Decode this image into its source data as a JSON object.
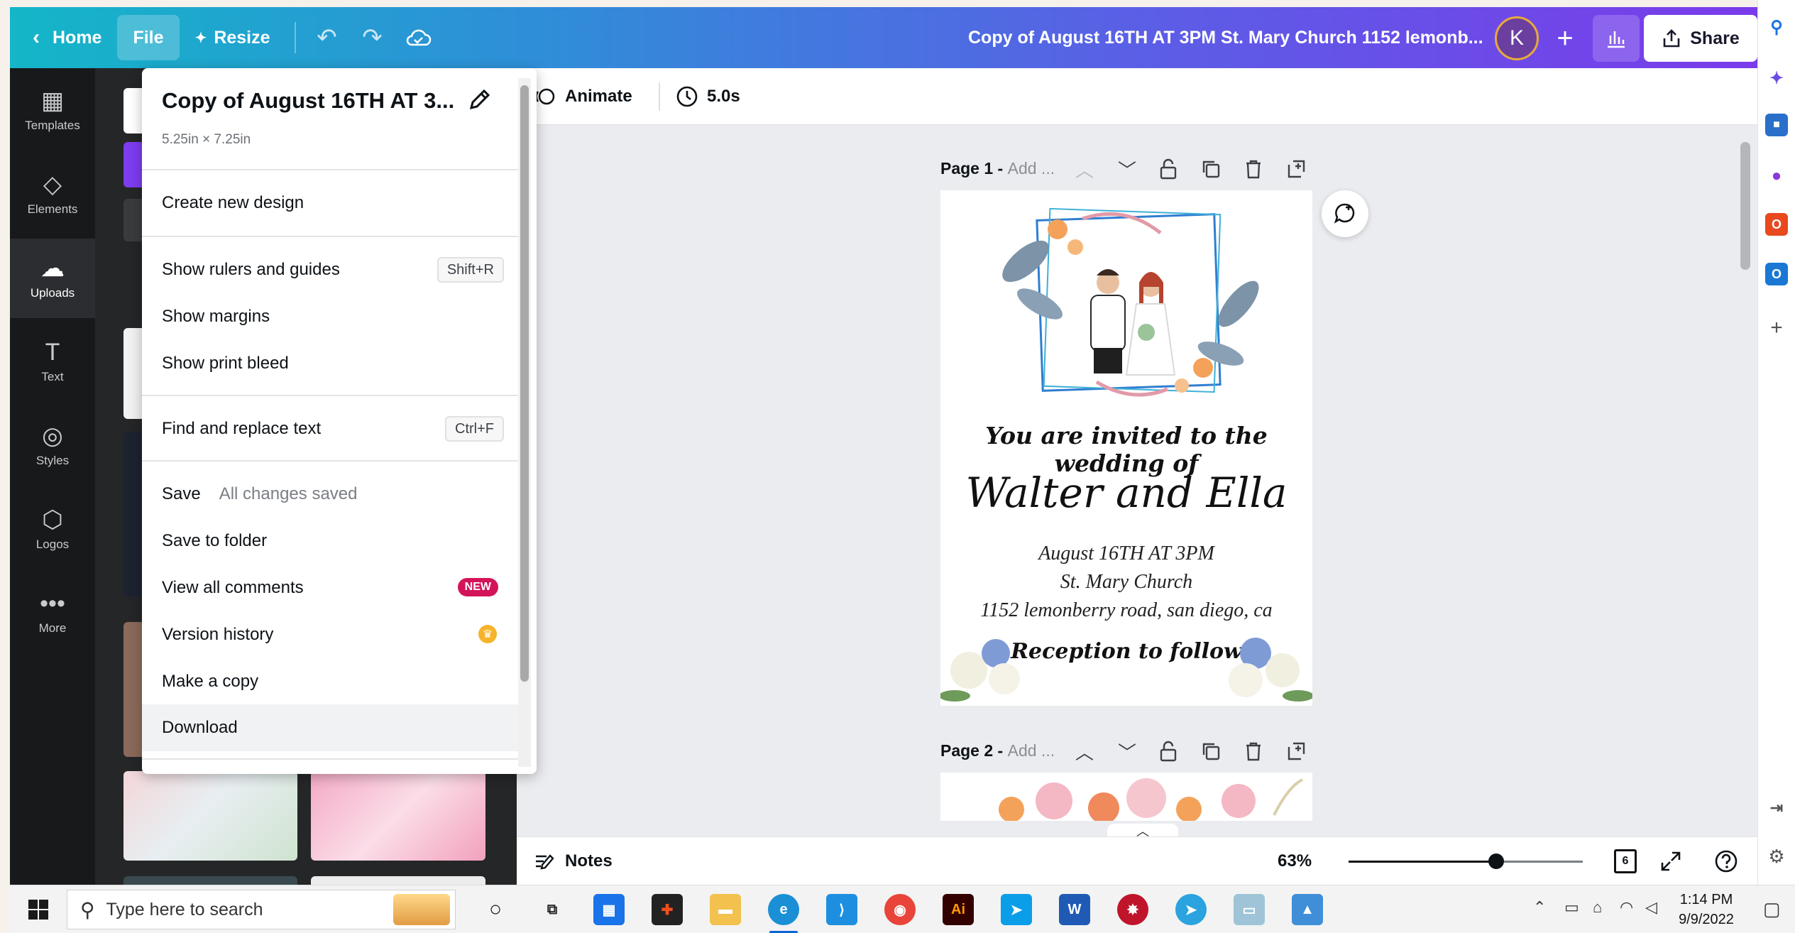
{
  "topbar": {
    "home_label": "Home",
    "file_label": "File",
    "resize_label": "Resize",
    "doc_title": "Copy of August 16TH AT 3PM St. Mary Church 1152 lemonb...",
    "avatar_initial": "K",
    "share_label": "Share",
    "gradient_start": "#14b6c8",
    "gradient_end": "#7a3bea"
  },
  "rail": {
    "items": [
      {
        "label": "Templates",
        "icon": "templates-icon"
      },
      {
        "label": "Elements",
        "icon": "elements-icon"
      },
      {
        "label": "Uploads",
        "icon": "uploads-icon"
      },
      {
        "label": "Text",
        "icon": "text-icon"
      },
      {
        "label": "Styles",
        "icon": "styles-icon"
      },
      {
        "label": "Logos",
        "icon": "logos-icon"
      },
      {
        "label": "More",
        "icon": "more-icon"
      }
    ]
  },
  "file_menu": {
    "title": "Copy of August 16TH AT 3...",
    "size": "5.25in × 7.25in",
    "items": {
      "create_new": "Create new design",
      "rulers": "Show rulers and guides",
      "rulers_shortcut": "Shift+R",
      "margins": "Show margins",
      "bleed": "Show print bleed",
      "find_replace": "Find and replace text",
      "find_shortcut": "Ctrl+F",
      "save": "Save",
      "save_status": "All changes saved",
      "save_folder": "Save to folder",
      "comments": "View all comments",
      "comments_badge": "NEW",
      "version_history": "Version history",
      "make_copy": "Make a copy",
      "download": "Download"
    }
  },
  "context_bar": {
    "animate_label": "Animate",
    "duration_label": "5.0s"
  },
  "pages": [
    {
      "label": "Page 1 -",
      "title_placeholder": "Add ..."
    },
    {
      "label": "Page 2 -",
      "title_placeholder": "Add ..."
    }
  ],
  "invitation": {
    "line1": "You are invited to the wedding of",
    "names": "Walter and Ella",
    "date": "August 16TH AT 3PM",
    "venue": "St. Mary Church",
    "address": "1152 lemonberry road, san diego, ca",
    "reception": "Reception to follow"
  },
  "bottom_bar": {
    "notes_label": "Notes",
    "zoom_label": "63%",
    "zoom_fraction": 0.63,
    "page_count": "6"
  },
  "taskbar": {
    "search_placeholder": "Type here to search",
    "time": "1:14 PM",
    "date": "9/9/2022"
  }
}
